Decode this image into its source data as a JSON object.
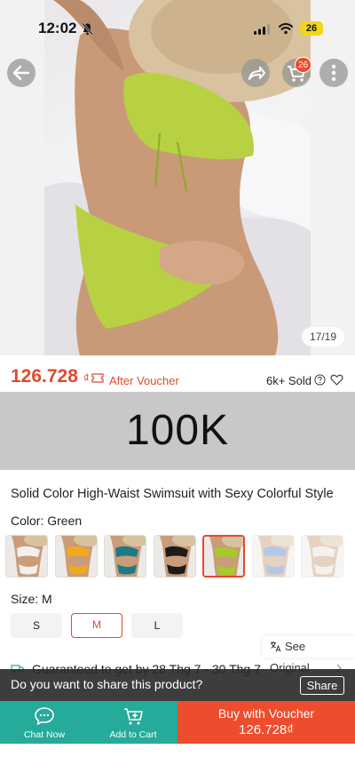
{
  "status_bar": {
    "time": "12:02",
    "battery": "26"
  },
  "header": {
    "cart_count": "26"
  },
  "gallery": {
    "page_indicator": "17/19"
  },
  "price": {
    "amount": "126.728",
    "currency": "₫",
    "after_voucher": "After Voucher",
    "sold": "6k+ Sold"
  },
  "banner": {
    "text": "100K"
  },
  "product": {
    "title": "Solid Color High-Waist Swimsuit with Sexy Colorful Style"
  },
  "color": {
    "label": "Color: ",
    "selected": "Green",
    "swatches": [
      {
        "color": "#f2f0ee",
        "state": "normal"
      },
      {
        "color": "#f2a91e",
        "state": "normal"
      },
      {
        "color": "#1d7b84",
        "state": "normal"
      },
      {
        "color": "#1b1b1b",
        "state": "normal"
      },
      {
        "color": "#a8c92c",
        "state": "selected"
      },
      {
        "color": "#5b87c9",
        "state": "faded"
      },
      {
        "color": "#e7e2da",
        "state": "faded"
      }
    ]
  },
  "size": {
    "label": "Size: ",
    "selected": "M",
    "options": [
      "S",
      "M",
      "L"
    ]
  },
  "translation": {
    "see_original": "See Original"
  },
  "shipping": {
    "guarantee": "Guaranteed to get by 28 Thg 7 - 30 Thg 7"
  },
  "share_prompt": {
    "text": "Do you want to share this product?",
    "button": "Share"
  },
  "bottom_bar": {
    "chat_now": "Chat Now",
    "add_to_cart": "Add to Cart",
    "buy_label": "Buy with Voucher",
    "buy_price": "126.728₫"
  },
  "colors": {
    "accent": "#ee4d2d",
    "price": "#e2492c",
    "teal": "#26aa99",
    "banner": "#c8c8c8"
  }
}
